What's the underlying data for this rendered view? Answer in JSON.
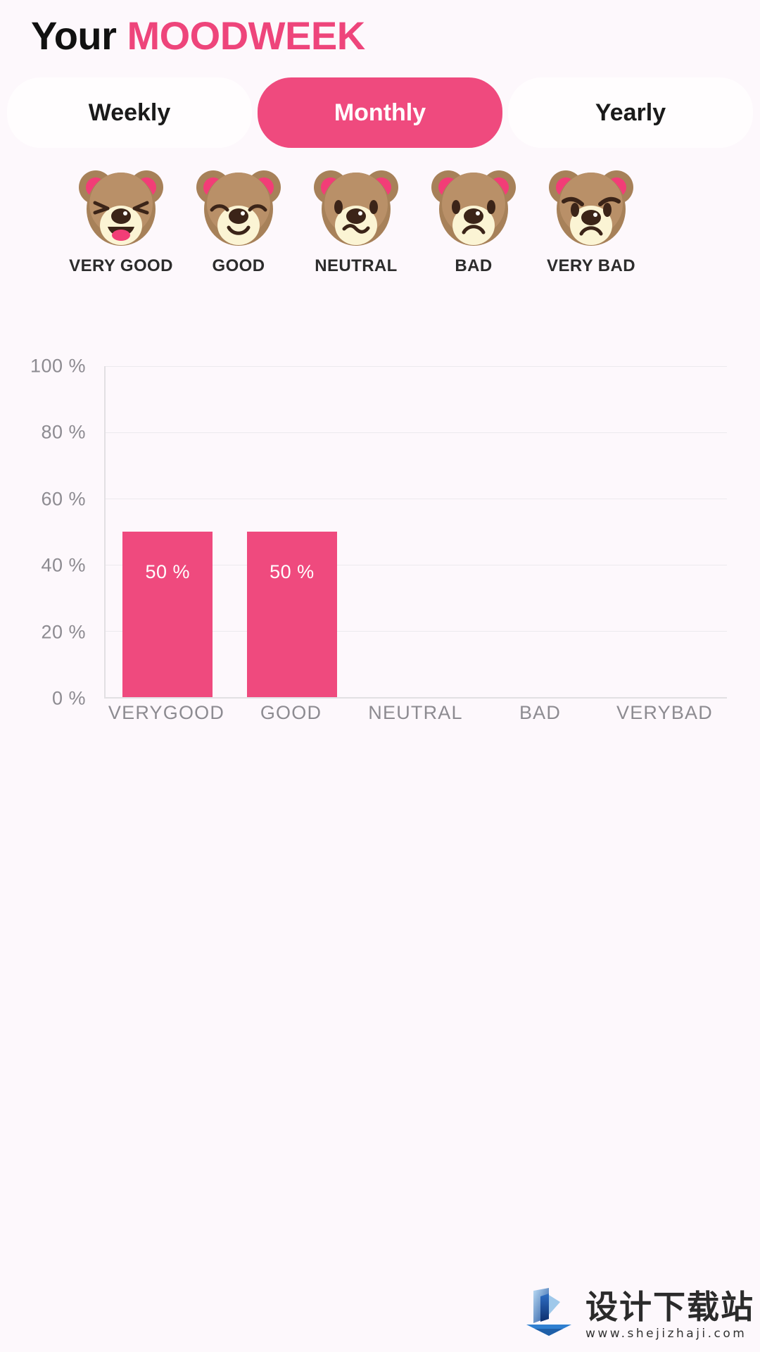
{
  "header": {
    "title_prefix": "Your",
    "title_brand": "MOODWEEK"
  },
  "tabs": [
    {
      "label": "Weekly",
      "active": false
    },
    {
      "label": "Monthly",
      "active": true
    },
    {
      "label": "Yearly",
      "active": false
    }
  ],
  "mood_legend": [
    {
      "label": "VERY GOOD",
      "icon": "bear-very-good-icon"
    },
    {
      "label": "GOOD",
      "icon": "bear-good-icon"
    },
    {
      "label": "NEUTRAL",
      "icon": "bear-neutral-icon"
    },
    {
      "label": "BAD",
      "icon": "bear-bad-icon"
    },
    {
      "label": "VERY BAD",
      "icon": "bear-very-bad-icon"
    }
  ],
  "chart_data": {
    "type": "bar",
    "title": "",
    "xlabel": "",
    "ylabel": "",
    "categories": [
      "VERYGOOD",
      "GOOD",
      "NEUTRAL",
      "BAD",
      "VERYBAD"
    ],
    "values": [
      50,
      50,
      0,
      0,
      0
    ],
    "value_labels": [
      "50 %",
      "50 %",
      "",
      "",
      ""
    ],
    "ylim": [
      0,
      100
    ],
    "yticks": [
      0,
      20,
      40,
      60,
      80,
      100
    ],
    "ytick_labels": [
      "0 %",
      "20 %",
      "40 %",
      "60 %",
      "80 %",
      "100 %"
    ],
    "grid": true,
    "legend": "none",
    "bar_color": "#ef4a7e"
  },
  "colors": {
    "brand_pink": "#ef4a7e",
    "background": "#fdf8fc",
    "text_dark": "#1a1a1a",
    "axis_text": "#8d8b91",
    "bear_fur": "#a78159",
    "bear_fur_light": "#b99068",
    "bear_muzzle": "#fbf4d4",
    "bear_ear_inner": "#f23d77",
    "bear_feature": "#3b2418"
  },
  "watermark": {
    "brand_cn": "设计下载站",
    "url": "www.shejizhaji.com"
  }
}
